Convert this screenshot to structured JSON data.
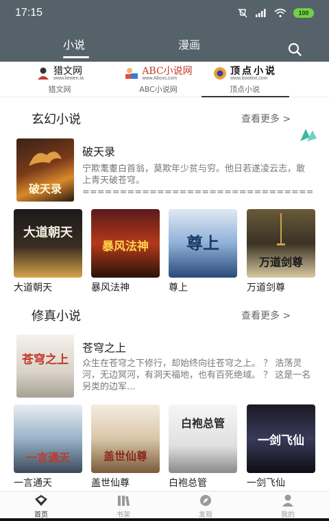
{
  "status_bar": {
    "time": "17:15",
    "battery": "100",
    "icons": [
      "mute-icon",
      "signal-icon",
      "wifi-icon",
      "battery-icon"
    ]
  },
  "header": {
    "tabs": [
      {
        "label": "小说",
        "active": true
      },
      {
        "label": "漫画",
        "active": false
      }
    ],
    "search_icon": "search-icon"
  },
  "sources": [
    {
      "logo_text": "猎文网",
      "logo_sub": "www.liewen.la",
      "logo_suffix": ".la",
      "label": "猎文网"
    },
    {
      "logo_text": "ABC小说网",
      "logo_sub": "www.Abcxs.com",
      "label": "ABC小说网"
    },
    {
      "logo_text": "顶点小说",
      "logo_sub": "www.booktxt.com",
      "label": "顶点小说",
      "active": true
    }
  ],
  "sections": [
    {
      "title": "玄幻小说",
      "more": "查看更多 >",
      "featured": {
        "title": "破天录",
        "description": "宁欺耄耋白首翁，莫欺年少贫与穷。他日若遂凌云志，敢上青天破苍穹。================================================= 2...",
        "cover_text": "破天录"
      },
      "books": [
        {
          "title": "大道朝天",
          "cover_text": "大道朝天"
        },
        {
          "title": "暴风法神",
          "cover_text": "暴风法神"
        },
        {
          "title": "尊上",
          "cover_text": "尊上"
        },
        {
          "title": "万道剑尊",
          "cover_text": "万道剑尊"
        }
      ]
    },
    {
      "title": "修真小说",
      "more": "查看更多 >",
      "featured": {
        "title": "苍穹之上",
        "description": "众生在苍穹之下修行，却始终向往苍穹之上。      ？      浩荡灵河，无边冥河，有洞天福地，也有百死绝域。      ？      这是一名另类的边军...",
        "cover_text": "苍穹之上"
      },
      "books": [
        {
          "title": "一言通天",
          "cover_text": "一言通天"
        },
        {
          "title": "盖世仙尊",
          "cover_text": "盖世仙尊"
        },
        {
          "title": "白袍总管",
          "cover_text": "白袍总管"
        },
        {
          "title": "一剑飞仙",
          "cover_text": "一剑飞仙"
        }
      ]
    }
  ],
  "bottom_nav": [
    {
      "label": "首页",
      "icon": "home-icon",
      "active": true
    },
    {
      "label": "书架",
      "icon": "bookshelf-icon",
      "active": false
    },
    {
      "label": "发现",
      "icon": "compass-icon",
      "active": false
    },
    {
      "label": "我的",
      "icon": "person-icon",
      "active": false
    }
  ],
  "colors": {
    "header_bg": "#56626a",
    "battery": "#6fd14a",
    "text_primary": "#222222",
    "text_secondary": "#777777"
  }
}
